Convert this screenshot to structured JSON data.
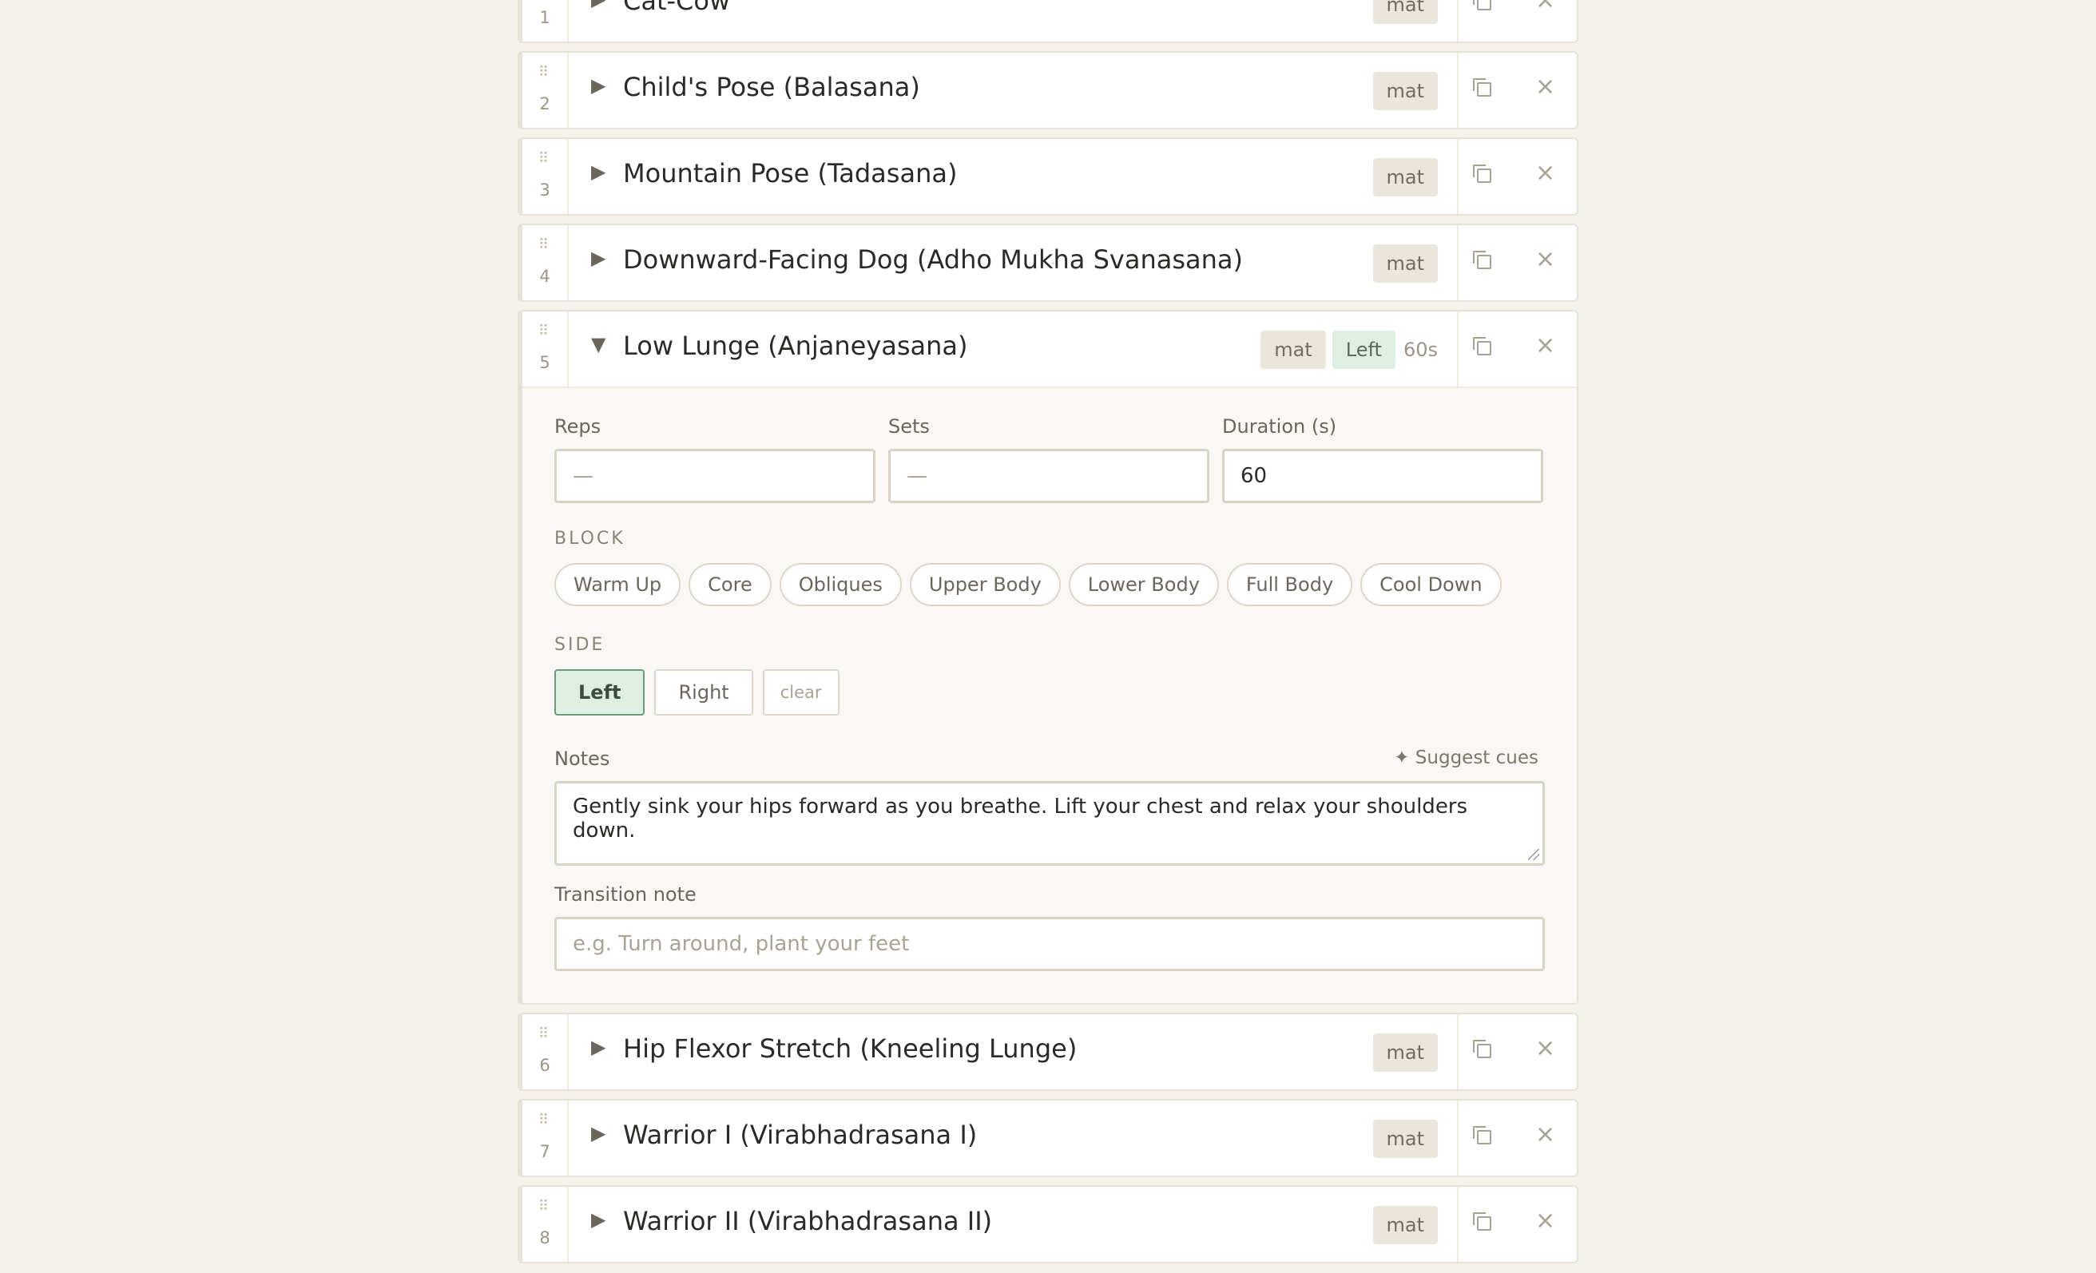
{
  "exercises": [
    {
      "num": "1",
      "name": "Cat-Cow",
      "tag": "mat"
    },
    {
      "num": "2",
      "name": "Child's Pose (Balasana)",
      "tag": "mat"
    },
    {
      "num": "3",
      "name": "Mountain Pose (Tadasana)",
      "tag": "mat"
    },
    {
      "num": "4",
      "name": "Downward-Facing Dog (Adho Mukha Svanasana)",
      "tag": "mat"
    },
    {
      "num": "5",
      "name": "Low Lunge (Anjaneyasana)",
      "tag": "mat",
      "side_tag": "Left",
      "duration_tag": "60s"
    },
    {
      "num": "6",
      "name": "Hip Flexor Stretch (Kneeling Lunge)",
      "tag": "mat"
    },
    {
      "num": "7",
      "name": "Warrior I (Virabhadrasana I)",
      "tag": "mat"
    },
    {
      "num": "8",
      "name": "Warrior II (Virabhadrasana II)",
      "tag": "mat"
    }
  ],
  "icons": {
    "grip": "drag-handle-icon",
    "expand": "triangle-right-icon",
    "collapse": "triangle-down-icon",
    "copy": "duplicate-icon",
    "close": "close-icon"
  },
  "detail": {
    "reps_label": "Reps",
    "reps_placeholder": "—",
    "sets_label": "Sets",
    "sets_placeholder": "—",
    "duration_label": "Duration (s)",
    "duration_value": "60",
    "block_heading": "BLOCK",
    "blocks": [
      "Warm Up",
      "Core",
      "Obliques",
      "Upper Body",
      "Lower Body",
      "Full Body",
      "Cool Down"
    ],
    "side_heading": "SIDE",
    "side_left": "Left",
    "side_right": "Right",
    "side_clear": "clear",
    "notes_label": "Notes",
    "suggest_label": "✦ Suggest cues",
    "notes_value": "Gently sink your hips forward as you breathe. Lift your chest and relax your shoulders down.",
    "transition_label": "Transition note",
    "transition_placeholder": "e.g. Turn around, plant your feet"
  },
  "colors": {
    "background": "#f5f2ec",
    "accent_green": "#ddefe3",
    "tag_bg": "#ebe6dc"
  }
}
